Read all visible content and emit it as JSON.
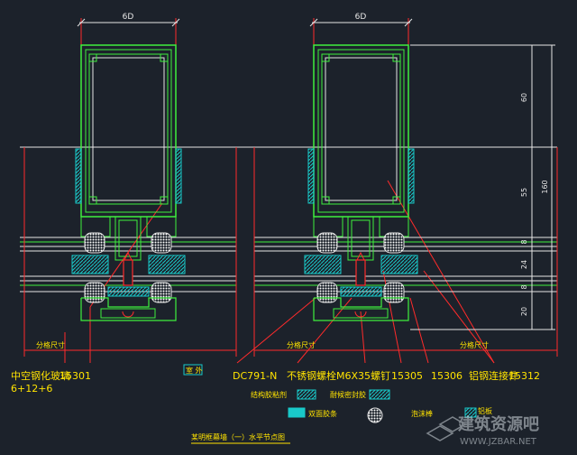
{
  "dimensions": {
    "left_top": "6D",
    "right_top": "6D",
    "right_side": [
      "60",
      "55",
      "8",
      "24",
      "8",
      "20"
    ],
    "right_overall": "160"
  },
  "labels": {
    "l_span": "分格尺寸",
    "m_span": "分格尺寸",
    "r_span": "分格尺寸",
    "glass": "中空钢化玻璃",
    "glass_code": "15301",
    "glass_spec": "6+12+6",
    "small_box": "室 外",
    "dc": "DC791-N",
    "bolt": "不锈钢螺栓M6X35螺钉",
    "c15305": "15305",
    "c15306": "15306",
    "anchor": "铝钢连接件",
    "c15312": "15312"
  },
  "legend": {
    "item1": "结构胶粘剂",
    "item2": "耐候密封胶",
    "item3": "双面胶条",
    "item4": "泡沫棒",
    "item5": "铝板",
    "title": "某明框幕墙（一）水平节点图"
  },
  "watermark": {
    "cn": "建筑资源吧",
    "url": "WWW.JZBAR.NET"
  },
  "colors": {
    "bg": "#1c222b",
    "line_green": "#3ef03e",
    "line_white": "#e6e6e6",
    "line_red": "#ff2b2b",
    "text_yellow": "#ffe300",
    "accent_cyan": "#19c9c9"
  }
}
